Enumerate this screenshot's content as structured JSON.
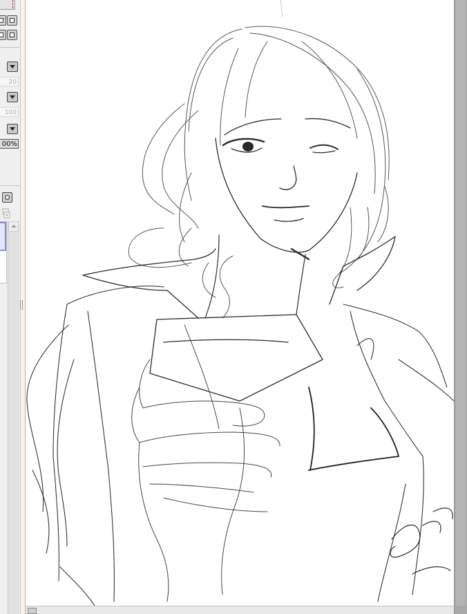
{
  "tool_panel": {
    "fields": {
      "value_20": "20",
      "value_100": "100",
      "zoom_percent": "00%"
    }
  },
  "colors": {
    "panel_bg": "#f0f0f0",
    "selection_accent": "#8b86e8",
    "scrollbar_track": "#a8a8a8",
    "marker_red": "#d02020",
    "stroke": "#2a2a2a"
  },
  "icons": [
    "square-brush-icon",
    "dropdown-arrow-icon",
    "circle-brush-icon",
    "new-layer-icon",
    "scroll-up-arrow-icon",
    "panel-grip-icon"
  ]
}
